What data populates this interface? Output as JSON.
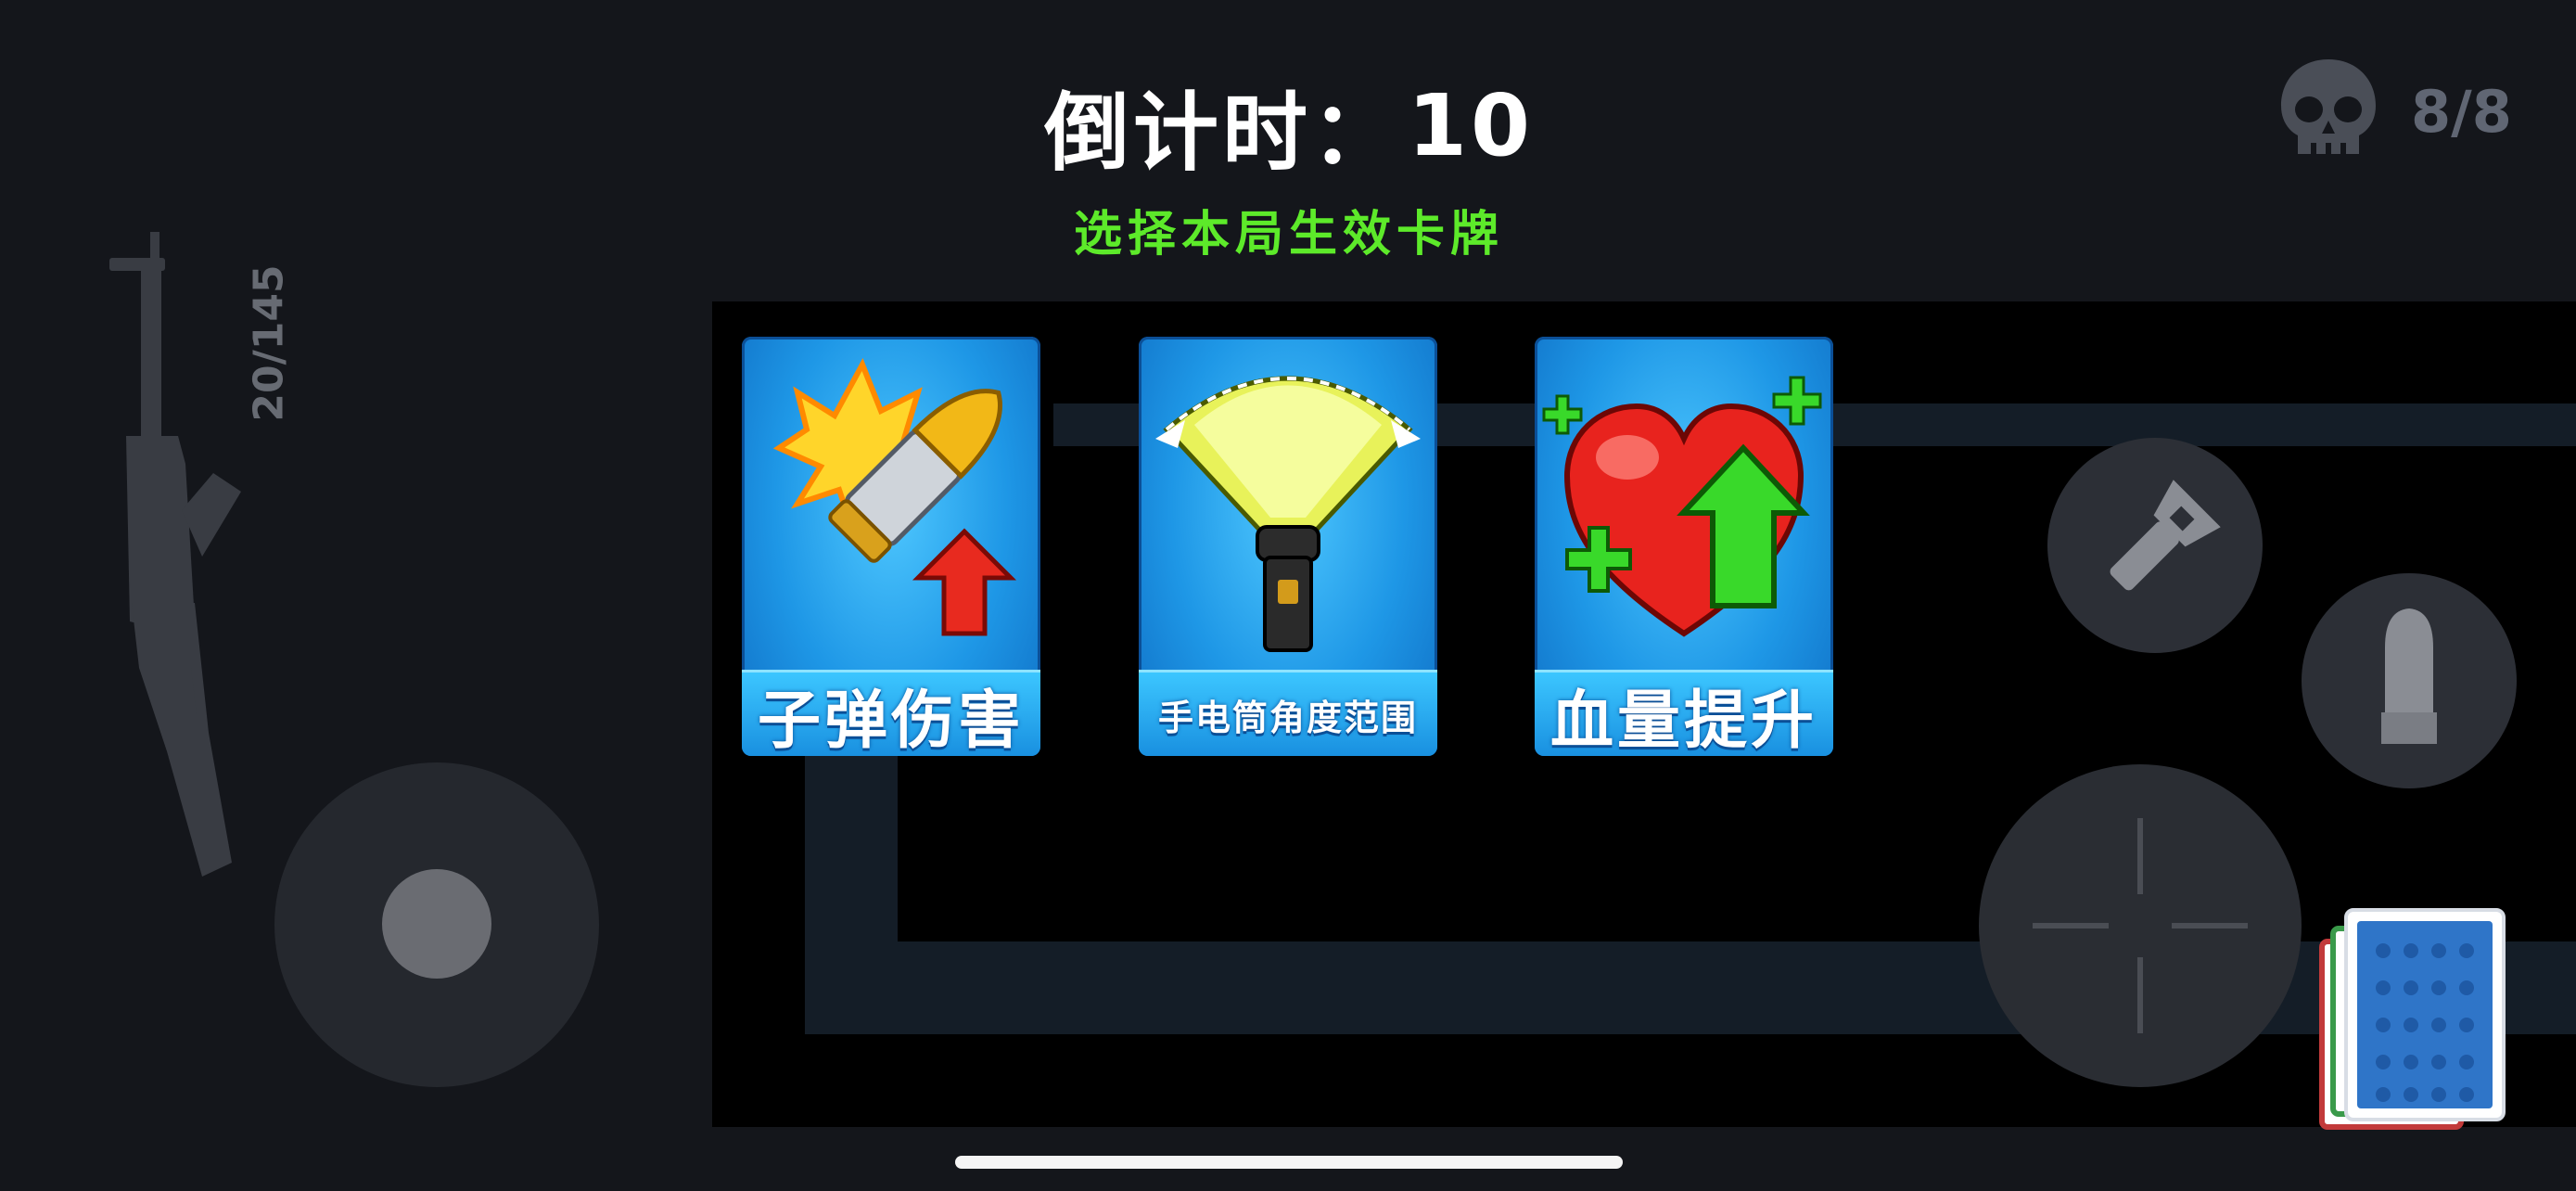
{
  "hud": {
    "countdown_label": "倒计时：",
    "countdown_value": "10",
    "subtitle": "选择本局生效卡牌",
    "kills": "8/8",
    "ammo": "20/145"
  },
  "cards": [
    {
      "label": "子弹伤害",
      "icon": "bullet-damage-up-icon"
    },
    {
      "label": "手电筒角度范围",
      "icon": "flashlight-beam-icon"
    },
    {
      "label": "血量提升",
      "icon": "heart-health-up-icon"
    }
  ],
  "controls": {
    "flashlight": "flashlight-icon",
    "reload": "bullet-icon",
    "fire": "crosshair-icon",
    "deck": "card-deck-icon"
  },
  "colors": {
    "background": "#14161b",
    "subtitle": "#5dea2a",
    "card_blue": "#1e97e6",
    "kills_text": "#606673"
  }
}
